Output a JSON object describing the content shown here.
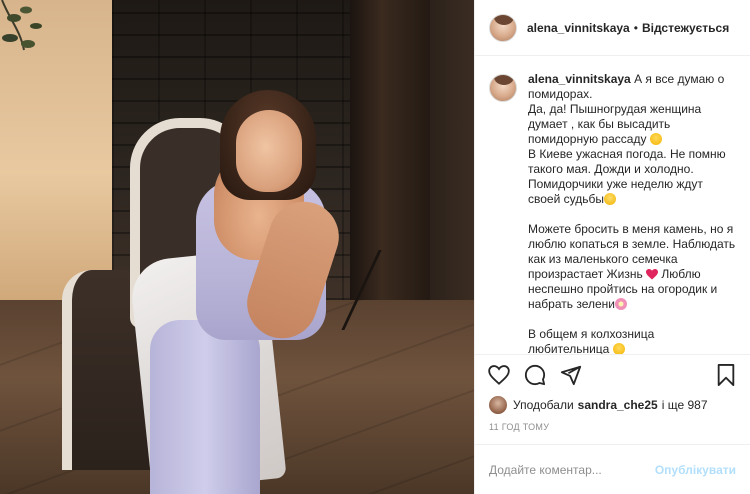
{
  "header": {
    "username": "alena_vinnitskaya",
    "separator": "•",
    "follow_status": "Відстежується"
  },
  "caption": {
    "username": "alena_vinnitskaya",
    "text_part1": " А я все думаю о помидорах.\nДа, да! Пышногрудая женщина думает , как бы высадить помидорную рассаду ",
    "text_part2": "\nВ Киеве ужасная погода. Не помню такого мая. Дожди и холодно. Помидорчики уже неделю ждут своей судьбы",
    "text_part3": "\n\nМожете бросить в меня камень, но я люблю копаться в земле. Наблюдать как из маленького семечка произрастает Жизнь ",
    "text_part4": " Люблю неспешно пройтись на огородик и набрать зелени",
    "text_part5": "\n\nВ общем я колхозница любительница ",
    "emoji_icons": [
      "grinning-sweat-emoji",
      "worried-emoji",
      "red-heart-emoji",
      "flower-emoji",
      "grinning-squint-emoji"
    ]
  },
  "actions": {
    "icons": [
      "heart-icon",
      "comment-icon",
      "share-icon",
      "bookmark-icon"
    ]
  },
  "likes": {
    "prefix": "Уподобали",
    "name": "sandra_che25",
    "suffix": "і ще 987"
  },
  "timestamp": "11 ГОД ТОМУ",
  "comment": {
    "placeholder": "Додайте коментар...",
    "post_label": "Опублікувати"
  },
  "colors": {
    "text": "#262626",
    "muted": "#8e8e8e",
    "border": "#efefef",
    "post_button_disabled": "#b2dffc",
    "heart_red": "#ed4956"
  }
}
